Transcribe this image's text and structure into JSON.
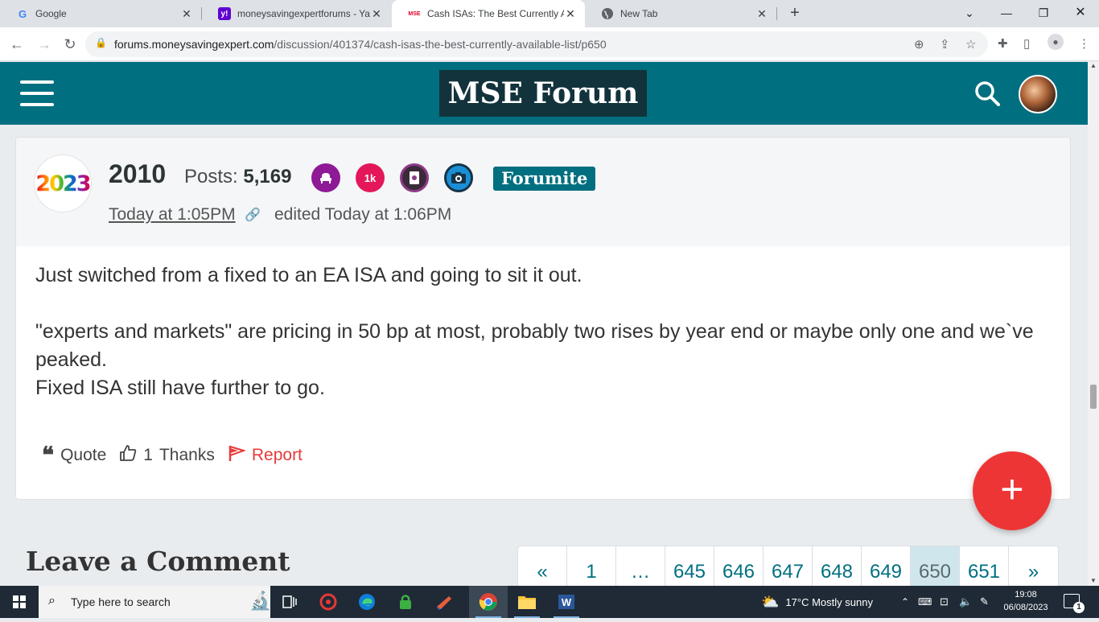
{
  "browser": {
    "tabs": [
      {
        "title": "Google",
        "favicon": "G"
      },
      {
        "title": "moneysavingexpertforums - Yaho",
        "favicon": "y!"
      },
      {
        "title": "Cash ISAs: The Best Currently Ava",
        "favicon": "MSE"
      },
      {
        "title": "New Tab",
        "favicon": "globe"
      }
    ],
    "new_tab_label": "+",
    "url_host": "forums.moneysavingexpert.com",
    "url_path": "/discussion/401374/cash-isas-the-best-currently-available-list/p650"
  },
  "site": {
    "logo": "MSE Forum"
  },
  "post": {
    "author": "2010",
    "avatar_text": "2023",
    "posts_label": "Posts:",
    "posts_count": "5,169",
    "badges": [
      {
        "icon": "armchair-icon",
        "text": "",
        "color": "#8e1a96"
      },
      {
        "icon": "1k-badge",
        "text": "1k",
        "color": "#e4175a"
      },
      {
        "icon": "notebook-icon",
        "text": "",
        "color": "#8e3a86"
      },
      {
        "icon": "camera-icon",
        "text": "",
        "color": "#1a8fd6"
      }
    ],
    "rank": "Forumite",
    "timestamp": "Today at 1:05PM",
    "edited": "edited Today at 1:06PM",
    "body": [
      "Just switched from a fixed to an EA ISA and going to sit it out.",
      "\"experts and markets\" are pricing in 50 bp at most, probably two rises by year end or maybe only one and we`ve peaked.",
      "Fixed ISA still have further to go."
    ],
    "actions": {
      "quote": "Quote",
      "thanks_count": "1",
      "thanks": "Thanks",
      "report": "Report"
    }
  },
  "fab_label": "+",
  "leave_comment": "Leave a Comment",
  "pagination": {
    "pages": [
      "«",
      "1",
      "…",
      "645",
      "646",
      "647",
      "648",
      "649",
      "650",
      "651",
      "»"
    ],
    "current": "650"
  },
  "taskbar": {
    "search_placeholder": "Type here to search",
    "weather": "17°C  Mostly sunny",
    "time": "19:08",
    "date": "06/08/2023",
    "notifications": "1"
  },
  "colors": {
    "brand_teal": "#006f80",
    "logo_bg": "#12333b",
    "fab_red": "#ee3535",
    "report_red": "#e63b3b"
  }
}
